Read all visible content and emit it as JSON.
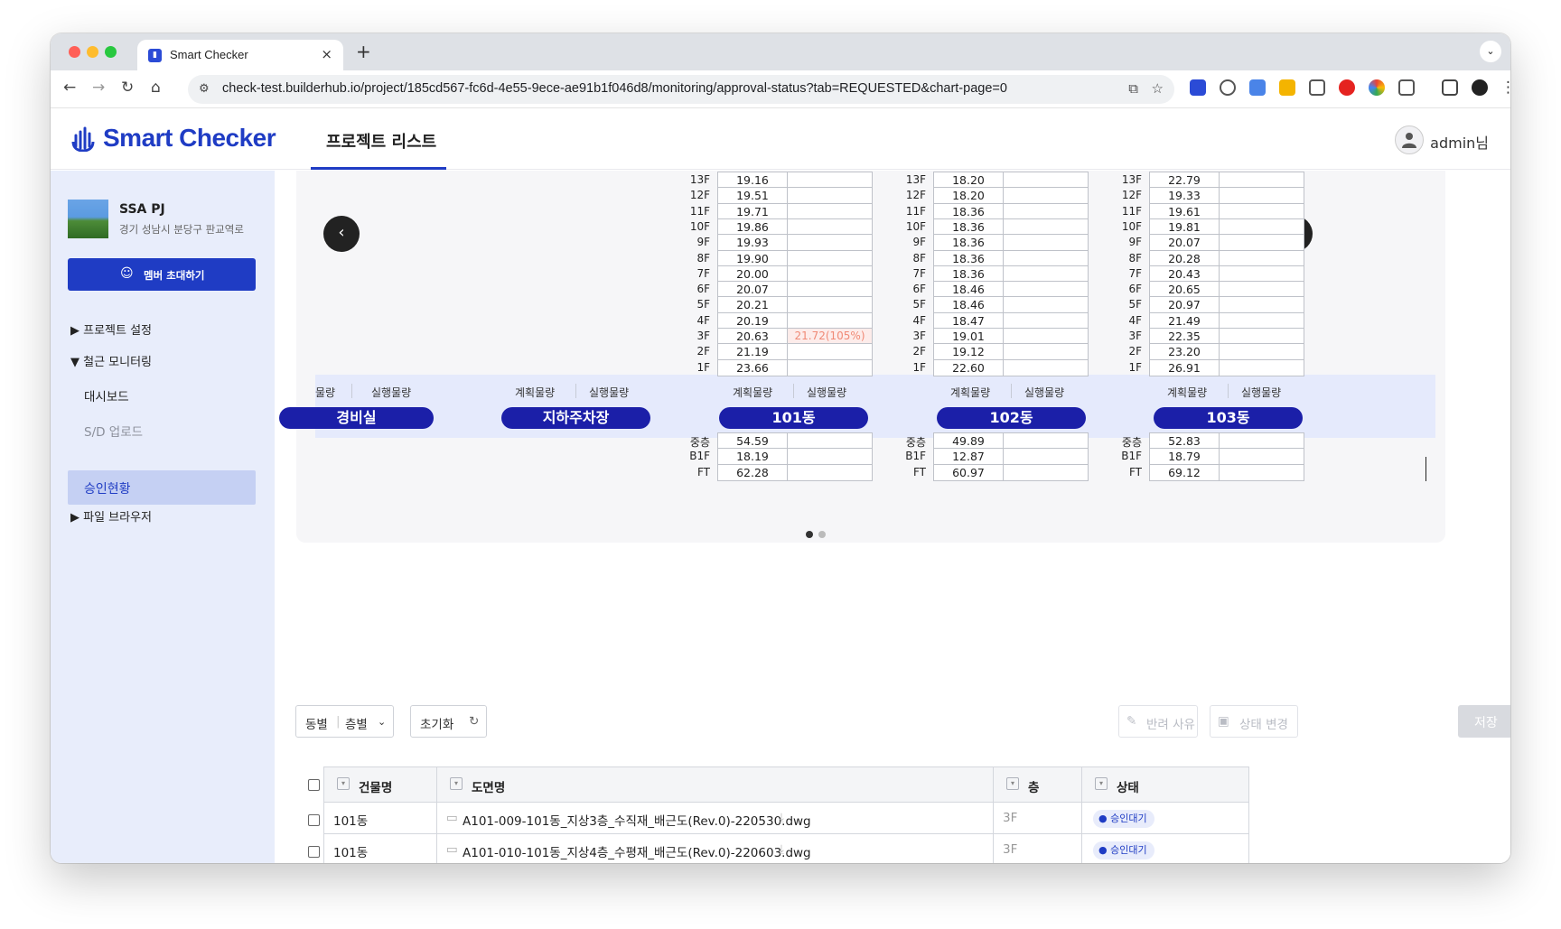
{
  "browser": {
    "tab_title": "Smart Checker",
    "url": "check-test.builderhub.io/project/185cd567-fc6d-4e55-9ece-ae91b1f046d8/monitoring/approval-status?tab=REQUESTED&chart-page=0"
  },
  "header": {
    "logo": "Smart Checker",
    "nav_tab": "프로젝트 리스트",
    "user": "admin님"
  },
  "sidebar": {
    "project_name": "SSA PJ",
    "project_address": "경기 성남시 분당구 판교역로",
    "invite_button": "멤버 초대하기",
    "items": [
      {
        "label": "▶ 프로젝트 설정"
      },
      {
        "label": "▼ 철근 모니터링"
      },
      {
        "label": "대시보드"
      },
      {
        "label": "S/D 업로드"
      },
      {
        "label": "승인현황"
      },
      {
        "label": "▶ 파일 브라우저"
      }
    ]
  },
  "chart": {
    "header_plan": "계획물량",
    "header_exec": "실행물량",
    "header_exec_cut": "물량",
    "buildings": [
      {
        "name": "경비실",
        "upper": [],
        "lower": []
      },
      {
        "name": "지하주차장",
        "upper": [],
        "lower": []
      },
      {
        "name": "101동",
        "upper": [
          {
            "floor": "13F",
            "plan": "19.16",
            "exec": ""
          },
          {
            "floor": "12F",
            "plan": "19.51",
            "exec": ""
          },
          {
            "floor": "11F",
            "plan": "19.71",
            "exec": ""
          },
          {
            "floor": "10F",
            "plan": "19.86",
            "exec": ""
          },
          {
            "floor": "9F",
            "plan": "19.93",
            "exec": ""
          },
          {
            "floor": "8F",
            "plan": "19.90",
            "exec": ""
          },
          {
            "floor": "7F",
            "plan": "20.00",
            "exec": ""
          },
          {
            "floor": "6F",
            "plan": "20.07",
            "exec": ""
          },
          {
            "floor": "5F",
            "plan": "20.21",
            "exec": ""
          },
          {
            "floor": "4F",
            "plan": "20.19",
            "exec": ""
          },
          {
            "floor": "3F",
            "plan": "20.63",
            "exec": "21.72(105%)"
          },
          {
            "floor": "2F",
            "plan": "21.19",
            "exec": ""
          },
          {
            "floor": "1F",
            "plan": "23.66",
            "exec": ""
          }
        ],
        "lower": [
          {
            "floor": "중층",
            "plan": "54.59",
            "exec": ""
          },
          {
            "floor": "B1F",
            "plan": "18.19",
            "exec": ""
          },
          {
            "floor": "FT",
            "plan": "62.28",
            "exec": ""
          }
        ]
      },
      {
        "name": "102동",
        "upper": [
          {
            "floor": "13F",
            "plan": "18.20",
            "exec": ""
          },
          {
            "floor": "12F",
            "plan": "18.20",
            "exec": ""
          },
          {
            "floor": "11F",
            "plan": "18.36",
            "exec": ""
          },
          {
            "floor": "10F",
            "plan": "18.36",
            "exec": ""
          },
          {
            "floor": "9F",
            "plan": "18.36",
            "exec": ""
          },
          {
            "floor": "8F",
            "plan": "18.36",
            "exec": ""
          },
          {
            "floor": "7F",
            "plan": "18.36",
            "exec": ""
          },
          {
            "floor": "6F",
            "plan": "18.46",
            "exec": ""
          },
          {
            "floor": "5F",
            "plan": "18.46",
            "exec": ""
          },
          {
            "floor": "4F",
            "plan": "18.47",
            "exec": ""
          },
          {
            "floor": "3F",
            "plan": "19.01",
            "exec": ""
          },
          {
            "floor": "2F",
            "plan": "19.12",
            "exec": ""
          },
          {
            "floor": "1F",
            "plan": "22.60",
            "exec": ""
          }
        ],
        "lower": [
          {
            "floor": "중층",
            "plan": "49.89",
            "exec": ""
          },
          {
            "floor": "B1F",
            "plan": "12.87",
            "exec": ""
          },
          {
            "floor": "FT",
            "plan": "60.97",
            "exec": ""
          }
        ]
      },
      {
        "name": "103동",
        "upper": [
          {
            "floor": "13F",
            "plan": "22.79",
            "exec": ""
          },
          {
            "floor": "12F",
            "plan": "19.33",
            "exec": ""
          },
          {
            "floor": "11F",
            "plan": "19.61",
            "exec": ""
          },
          {
            "floor": "10F",
            "plan": "19.81",
            "exec": ""
          },
          {
            "floor": "9F",
            "plan": "20.07",
            "exec": ""
          },
          {
            "floor": "8F",
            "plan": "20.28",
            "exec": ""
          },
          {
            "floor": "7F",
            "plan": "20.43",
            "exec": ""
          },
          {
            "floor": "6F",
            "plan": "20.65",
            "exec": ""
          },
          {
            "floor": "5F",
            "plan": "20.97",
            "exec": ""
          },
          {
            "floor": "4F",
            "plan": "21.49",
            "exec": ""
          },
          {
            "floor": "3F",
            "plan": "22.35",
            "exec": ""
          },
          {
            "floor": "2F",
            "plan": "23.20",
            "exec": ""
          },
          {
            "floor": "1F",
            "plan": "26.91",
            "exec": ""
          }
        ],
        "lower": [
          {
            "floor": "중층",
            "plan": "52.83",
            "exec": ""
          },
          {
            "floor": "B1F",
            "plan": "18.79",
            "exec": ""
          },
          {
            "floor": "FT",
            "plan": "69.12",
            "exec": ""
          }
        ]
      }
    ],
    "colors": {
      "pill": "#1b1fa8",
      "accent": "#1f3cc4",
      "over": "#f08a76"
    }
  },
  "controls": {
    "filter_dong": "동별",
    "filter_floor": "층별",
    "reset": "초기화",
    "reject_reason": "반려 사유",
    "change_status": "상태 변경",
    "save": "저장"
  },
  "table": {
    "headers": [
      "건물명",
      "도면명",
      "층",
      "상태"
    ],
    "rows": [
      {
        "building": "101동",
        "drawing": "A101-009-101동_지상3층_수직재_배근도(Rev.0)-220530.dwg",
        "floor": "3F",
        "status": "승인대기"
      },
      {
        "building": "101동",
        "drawing": "A101-010-101동_지상4층_수평재_배근도(Rev.0)-220603.dwg",
        "floor": "3F",
        "status": "승인대기"
      }
    ]
  }
}
